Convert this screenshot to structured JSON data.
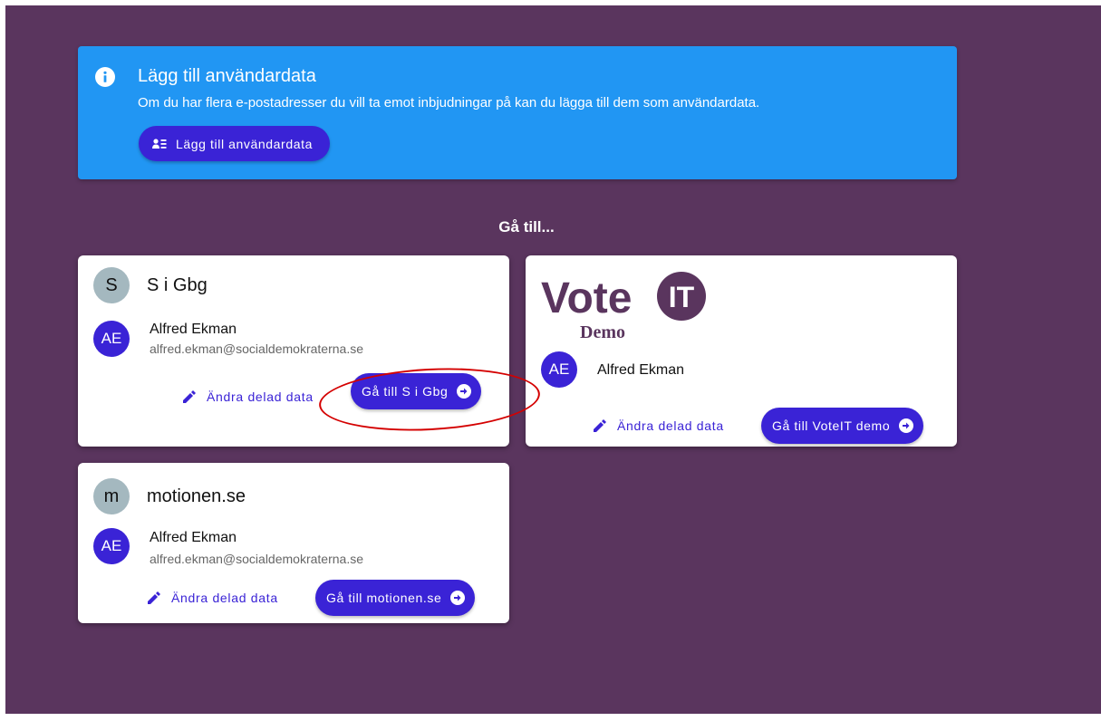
{
  "banner": {
    "title": "Lägg till användardata",
    "text": "Om du har flera e-postadresser du vill ta emot inbjudningar på kan du lägga till dem som användardata.",
    "button_label": "Lägg till användardata"
  },
  "goto_title": "Gå till...",
  "cards": [
    {
      "org_initial": "S",
      "org_name": "S i Gbg",
      "user_initials": "AE",
      "user_name": "Alfred Ekman",
      "user_email": "alfred.ekman@socialdemokraterna.se",
      "edit_label": "Ändra delad data",
      "goto_label": "Gå till S i Gbg"
    },
    {
      "logo_text": "Vote",
      "logo_badge": "IT",
      "logo_sub": "Demo",
      "user_initials": "AE",
      "user_name": "Alfred Ekman",
      "edit_label": "Ändra delad data",
      "goto_label": "Gå till VoteIT demo"
    },
    {
      "org_initial": "m",
      "org_name": "motionen.se",
      "user_initials": "AE",
      "user_name": "Alfred Ekman",
      "user_email": "alfred.ekman@socialdemokraterna.se",
      "edit_label": "Ändra delad data",
      "goto_label": "Gå till motionen.se"
    }
  ],
  "colors": {
    "background": "#5a355e",
    "banner": "#2196f3",
    "primary": "#3a23d6",
    "org_avatar": "#a4b8bf",
    "annotation": "#d40000"
  }
}
